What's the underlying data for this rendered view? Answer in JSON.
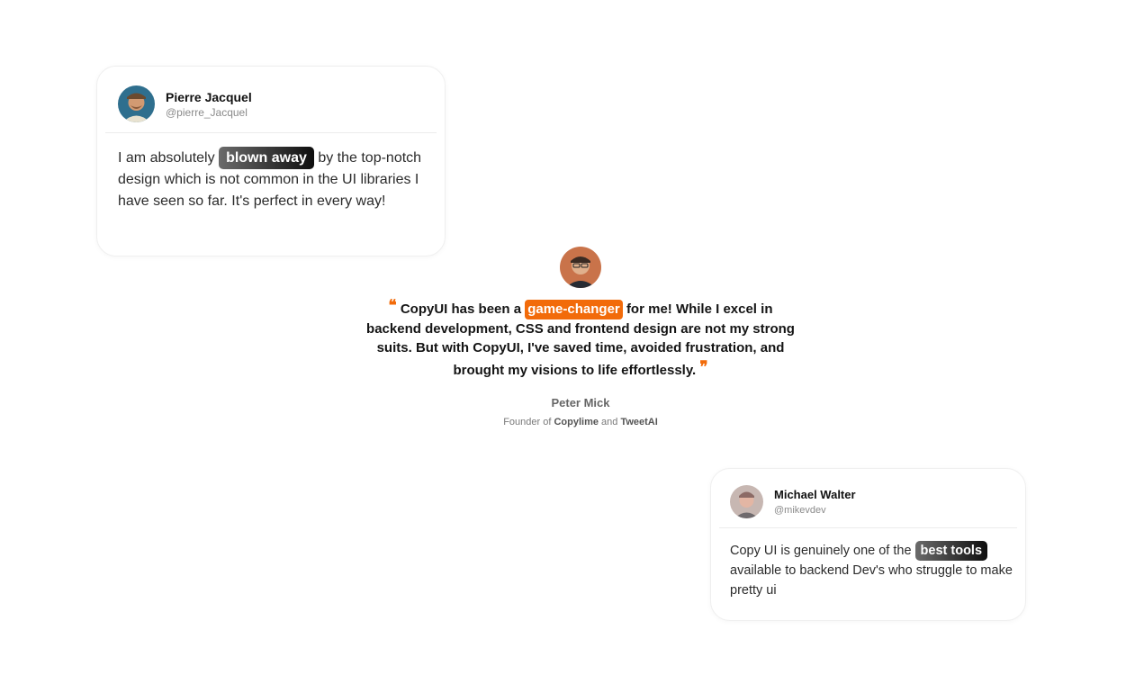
{
  "cards": {
    "left": {
      "name": "Pierre Jacquel",
      "handle": "@pierre_Jacquel",
      "text_before": "I am absolutely",
      "highlight": "blown away",
      "text_after": "by the top-notch design which is not common in the UI libraries I have seen so far. It's perfect in every way!"
    },
    "right": {
      "name": "Michael Walter",
      "handle": "@mikevdev",
      "text_before": "Copy UI is genuinely one of the",
      "highlight": "best tools",
      "text_after": "available to backend Dev's who struggle to make pretty ui"
    }
  },
  "featured": {
    "open_quote": "❝",
    "close_quote": "❞",
    "quote_before": "CopyUI has been a",
    "highlight": "game-changer",
    "quote_after": "for me! While I excel in backend development, CSS and frontend design are not my strong suits. But with CopyUI, I've saved time, avoided frustration, and brought my visions to life effortlessly.",
    "name": "Peter Mick",
    "role_prefix": "Founder of",
    "company_1": "Copylime",
    "role_join": "and",
    "company_2": "TweetAI"
  },
  "colors": {
    "accent": "#f26b0a",
    "highlight_dark": "#0e0e0e"
  }
}
